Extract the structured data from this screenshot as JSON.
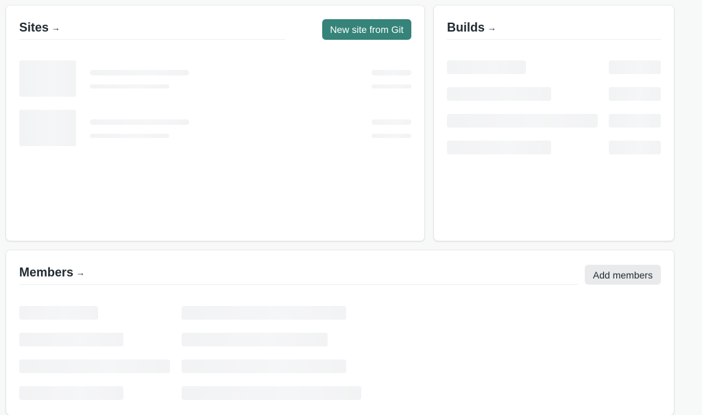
{
  "sites": {
    "title": "Sites",
    "arrow": "→",
    "cta_label": "New site from Git"
  },
  "builds": {
    "title": "Builds",
    "arrow": "→"
  },
  "members": {
    "title": "Members",
    "arrow": "→",
    "cta_label": "Add members"
  },
  "colors": {
    "accent": "#358379",
    "background": "#f7f9f9",
    "card": "#ffffff",
    "skeleton": "#f2f3f4",
    "text": "#1f2a30"
  },
  "state": "loading"
}
